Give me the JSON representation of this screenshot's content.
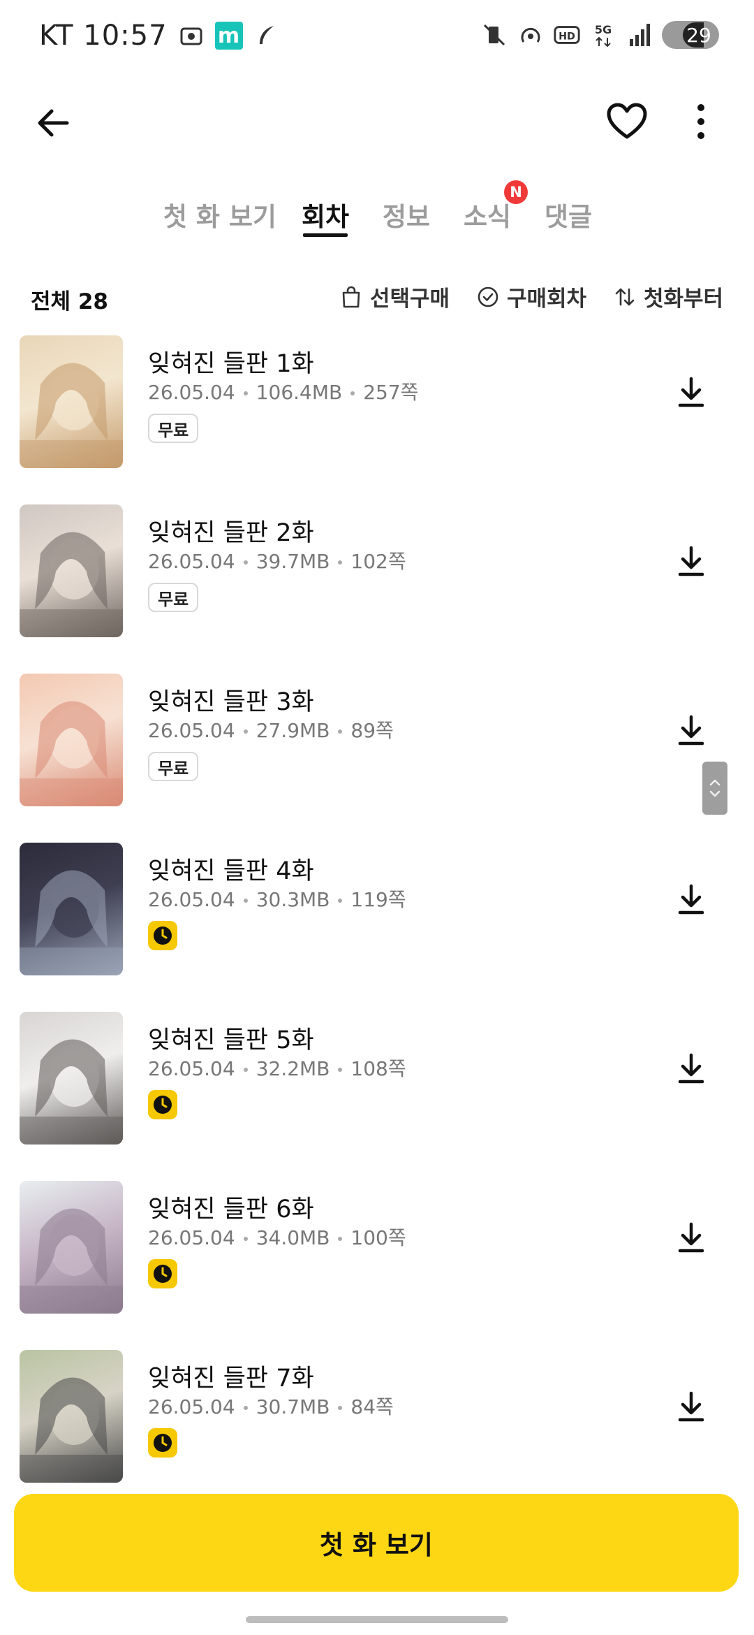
{
  "status_bar": {
    "carrier_time": "KT 10:57",
    "app_icon_label": "m",
    "battery_level": "29",
    "icons_left": [
      "screenshot-icon",
      "m-app-icon",
      "feather-icon"
    ],
    "icons_right": [
      "vibrate-mute-icon",
      "hotspot-icon",
      "hd-icon",
      "5g-icon",
      "signal-icon",
      "battery-icon"
    ]
  },
  "header": {
    "icons": [
      "back-arrow-icon",
      "heart-icon",
      "more-vertical-icon"
    ]
  },
  "tabs": [
    {
      "label": "첫 화 보기",
      "active": false
    },
    {
      "label": "회차",
      "active": true
    },
    {
      "label": "정보",
      "active": false
    },
    {
      "label": "소식",
      "active": false,
      "badge": "N"
    },
    {
      "label": "댓글",
      "active": false
    }
  ],
  "filters": {
    "total": "전체 28",
    "select_purchase": "선택구매",
    "purchased": "구매회차",
    "sort": "첫화부터"
  },
  "episodes": [
    {
      "title": "잊혀진 들판 1화",
      "date": "26.05.04",
      "size": "106.4MB",
      "pages": "257쪽",
      "badge": "무료",
      "badge_type": "free",
      "thumb_colors": [
        "#e9d6b8",
        "#c49a6b",
        "#f3e6cf"
      ]
    },
    {
      "title": "잊혀진 들판 2화",
      "date": "26.05.04",
      "size": "39.7MB",
      "pages": "102쪽",
      "badge": "무료",
      "badge_type": "free",
      "thumb_colors": [
        "#cfc7c2",
        "#6e6560",
        "#e9dfd6"
      ]
    },
    {
      "title": "잊혀진 들판 3화",
      "date": "26.05.04",
      "size": "27.9MB",
      "pages": "89쪽",
      "badge": "무료",
      "badge_type": "free",
      "thumb_colors": [
        "#f3c9b2",
        "#d98a74",
        "#f7e1d3"
      ]
    },
    {
      "title": "잊혀진 들판 4화",
      "date": "26.05.04",
      "size": "30.3MB",
      "pages": "119쪽",
      "badge": "",
      "badge_type": "wait",
      "thumb_colors": [
        "#2b2b3a",
        "#9aa3b5",
        "#3f3f52"
      ]
    },
    {
      "title": "잊혀진 들판 5화",
      "date": "26.05.04",
      "size": "32.2MB",
      "pages": "108쪽",
      "badge": "",
      "badge_type": "wait",
      "thumb_colors": [
        "#d8d5d3",
        "#5e5a58",
        "#efeeec"
      ]
    },
    {
      "title": "잊혀진 들판 6화",
      "date": "26.05.04",
      "size": "34.0MB",
      "pages": "100쪽",
      "badge": "",
      "badge_type": "wait",
      "thumb_colors": [
        "#e8eef0",
        "#8c7a8e",
        "#c8b8c8"
      ]
    },
    {
      "title": "잊혀진 들판 7화",
      "date": "26.05.04",
      "size": "30.7MB",
      "pages": "84쪽",
      "badge": "",
      "badge_type": "wait",
      "thumb_colors": [
        "#b9c4a2",
        "#4a4a4a",
        "#d7d3c6"
      ]
    }
  ],
  "cta": {
    "label": "첫 화 보기"
  },
  "colors": {
    "accent_yellow": "#fed714",
    "badge_red": "#f03a3a",
    "wait_yellow": "#f5c800"
  }
}
